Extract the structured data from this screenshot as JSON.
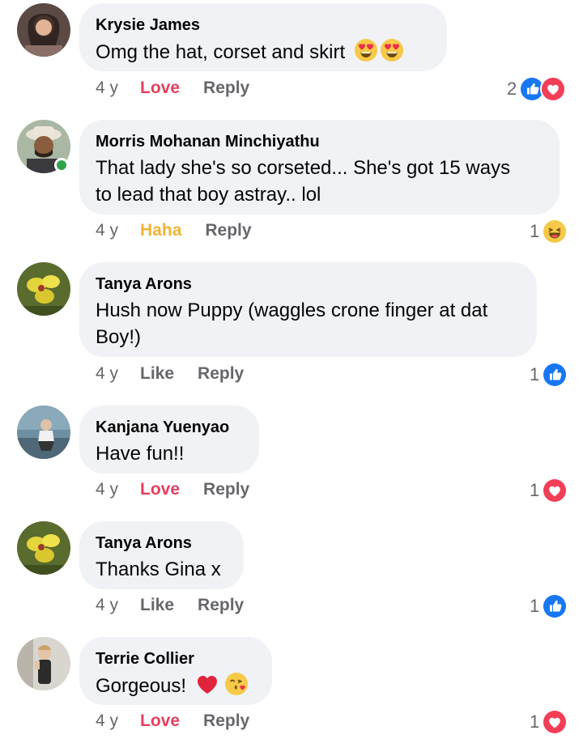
{
  "comments": [
    {
      "author": "Krysie James",
      "text": "Omg the hat, corset and skirt",
      "time": "4 y",
      "reaction_label": "Love",
      "reply_label": "Reply",
      "reaction_count": "2",
      "reaction_icons": [
        "like-icon",
        "love-icon"
      ],
      "inline_emojis": [
        "heart-eyes-emoji",
        "heart-eyes-emoji"
      ]
    },
    {
      "author": "Morris Mohanan Minchiyathu",
      "text_lines": [
        "That lady she's so corseted... She's got 15 ways",
        "to lead that boy astray..  lol"
      ],
      "time": "4 y",
      "reaction_label": "Haha",
      "reply_label": "Reply",
      "reaction_count": "1",
      "reaction_icons": [
        "haha-icon"
      ],
      "online": true
    },
    {
      "author": "Tanya Arons",
      "text_lines": [
        "Hush now Puppy (waggles crone finger at dat",
        "Boy!)"
      ],
      "time": "4 y",
      "reaction_label": "Like",
      "reply_label": "Reply",
      "reaction_count": "1",
      "reaction_icons": [
        "like-icon"
      ]
    },
    {
      "author": "Kanjana Yuenyao",
      "text": "Have fun!!",
      "time": "4 y",
      "reaction_label": "Love",
      "reply_label": "Reply",
      "reaction_count": "1",
      "reaction_icons": [
        "love-icon"
      ]
    },
    {
      "author": "Tanya Arons",
      "text": "Thanks Gina x",
      "time": "4 y",
      "reaction_label": "Like",
      "reply_label": "Reply",
      "reaction_count": "1",
      "reaction_icons": [
        "like-icon"
      ]
    },
    {
      "author": "Terrie Collier",
      "text": "Gorgeous!",
      "time": "4 y",
      "reaction_label": "Love",
      "reply_label": "Reply",
      "reaction_count": "1",
      "reaction_icons": [
        "love-icon"
      ],
      "inline_emojis": [
        "red-heart-emoji",
        "kissing-face-emoji"
      ]
    }
  ],
  "colors": {
    "bubble": "#f0f2f5",
    "love": "#e4405f",
    "haha": "#f1b434",
    "like_blue": "#1877f2",
    "muted": "#65676b",
    "online": "#31a24c"
  }
}
